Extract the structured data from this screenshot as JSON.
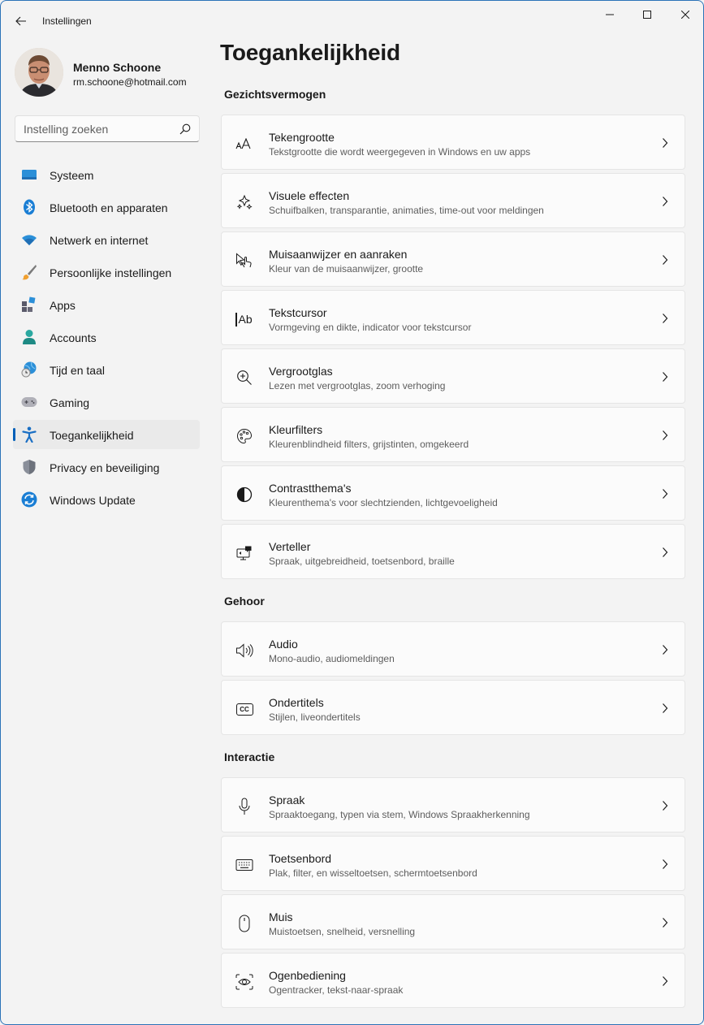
{
  "window": {
    "title": "Instellingen"
  },
  "profile": {
    "name": "Menno Schoone",
    "email": "rm.schoone@hotmail.com"
  },
  "search": {
    "placeholder": "Instelling zoeken"
  },
  "nav": {
    "items": [
      {
        "label": "Systeem",
        "icon": "monitor-icon"
      },
      {
        "label": "Bluetooth en apparaten",
        "icon": "bluetooth-icon"
      },
      {
        "label": "Netwerk en internet",
        "icon": "wifi-icon"
      },
      {
        "label": "Persoonlijke instellingen",
        "icon": "paintbrush-icon"
      },
      {
        "label": "Apps",
        "icon": "apps-icon"
      },
      {
        "label": "Accounts",
        "icon": "person-icon"
      },
      {
        "label": "Tijd en taal",
        "icon": "globe-clock-icon"
      },
      {
        "label": "Gaming",
        "icon": "gamepad-icon"
      },
      {
        "label": "Toegankelijkheid",
        "icon": "accessibility-icon",
        "active": true
      },
      {
        "label": "Privacy en beveiliging",
        "icon": "shield-icon"
      },
      {
        "label": "Windows Update",
        "icon": "update-icon"
      }
    ]
  },
  "main": {
    "title": "Toegankelijkheid",
    "sections": [
      {
        "title": "Gezichtsvermogen",
        "cards": [
          {
            "title": "Tekengrootte",
            "subtitle": "Tekstgrootte die wordt weergegeven in Windows en uw apps",
            "icon": "text-size-icon"
          },
          {
            "title": "Visuele effecten",
            "subtitle": "Schuifbalken, transparantie, animaties, time-out voor meldingen",
            "icon": "sparkle-icon"
          },
          {
            "title": "Muisaanwijzer en aanraken",
            "subtitle": "Kleur van de muisaanwijzer, grootte",
            "icon": "pointer-touch-icon"
          },
          {
            "title": "Tekstcursor",
            "subtitle": "Vormgeving en dikte, indicator voor tekstcursor",
            "icon": "text-cursor-icon",
            "glyph": "Ab"
          },
          {
            "title": "Vergrootglas",
            "subtitle": "Lezen met vergrootglas, zoom verhoging",
            "icon": "magnifier-icon"
          },
          {
            "title": "Kleurfilters",
            "subtitle": "Kleurenblindheid filters, grijstinten, omgekeerd",
            "icon": "palette-icon"
          },
          {
            "title": "Contrastthema's",
            "subtitle": "Kleurenthema's voor slechtzienden, lichtgevoeligheid",
            "icon": "contrast-icon"
          },
          {
            "title": "Verteller",
            "subtitle": "Spraak, uitgebreidheid, toetsenbord, braille",
            "icon": "narrator-icon"
          }
        ]
      },
      {
        "title": "Gehoor",
        "cards": [
          {
            "title": "Audio",
            "subtitle": "Mono-audio, audiomeldingen",
            "icon": "speaker-icon"
          },
          {
            "title": "Ondertitels",
            "subtitle": "Stijlen, liveondertitels",
            "icon": "captions-icon",
            "glyph": "CC"
          }
        ]
      },
      {
        "title": "Interactie",
        "cards": [
          {
            "title": "Spraak",
            "subtitle": "Spraaktoegang, typen via stem, Windows Spraakherkenning",
            "icon": "microphone-icon"
          },
          {
            "title": "Toetsenbord",
            "subtitle": "Plak, filter, en wisseltoetsen, schermtoetsenbord",
            "icon": "keyboard-icon"
          },
          {
            "title": "Muis",
            "subtitle": "Muistoetsen, snelheid, versnelling",
            "icon": "mouse-icon"
          },
          {
            "title": "Ogenbediening",
            "subtitle": "Ogentracker, tekst-naar-spraak",
            "icon": "eye-control-icon"
          }
        ]
      }
    ]
  },
  "colors": {
    "accent": "#005fb8",
    "background": "#f3f3f3",
    "card": "#fbfbfb"
  }
}
